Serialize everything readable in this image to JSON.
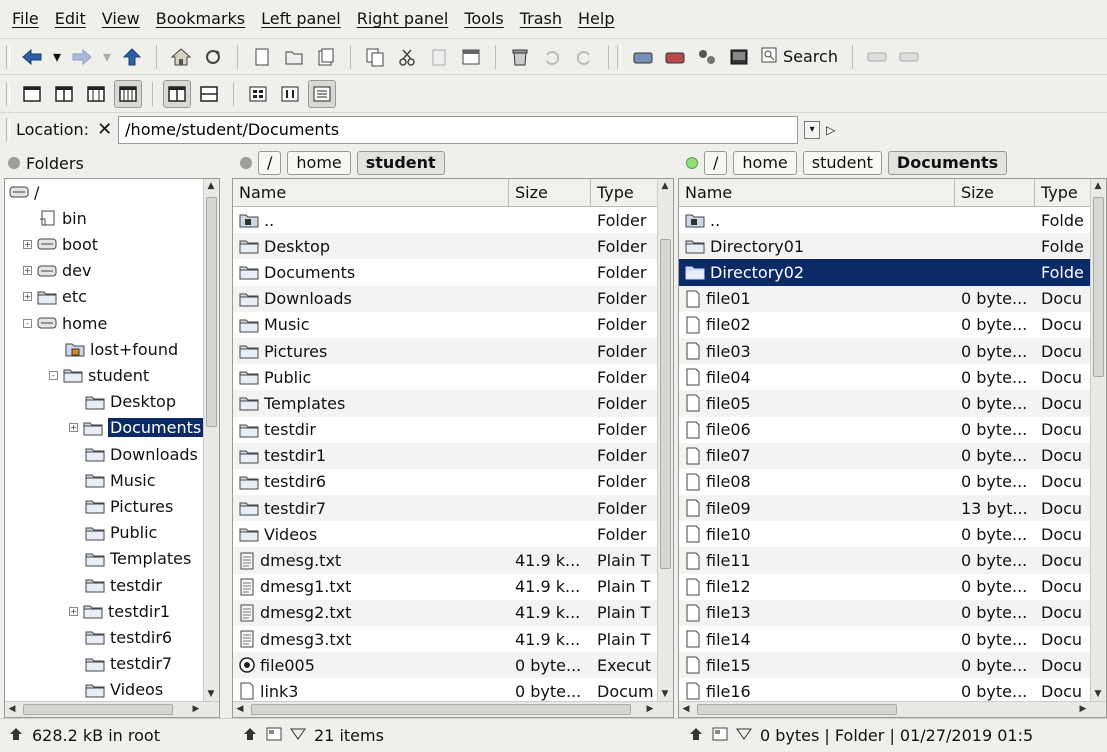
{
  "menu": [
    "File",
    "Edit",
    "View",
    "Bookmarks",
    "Left panel",
    "Right panel",
    "Tools",
    "Trash",
    "Help"
  ],
  "menu_accel": [
    0,
    0,
    0,
    0,
    0,
    0,
    0,
    0,
    0
  ],
  "toolbar": {
    "search_label": "Search"
  },
  "location": {
    "label": "Location:",
    "value": "/home/student/Documents"
  },
  "folders": {
    "title": "Folders",
    "items": [
      {
        "label": "/",
        "depth": 0,
        "icon": "drive"
      },
      {
        "label": "bin",
        "depth": 1,
        "icon": "link"
      },
      {
        "label": "boot",
        "depth": 1,
        "icon": "drive",
        "exp": "+"
      },
      {
        "label": "dev",
        "depth": 1,
        "icon": "drive",
        "exp": "+"
      },
      {
        "label": "etc",
        "depth": 1,
        "icon": "folder",
        "exp": "+"
      },
      {
        "label": "home",
        "depth": 1,
        "icon": "drive",
        "exp": "-"
      },
      {
        "label": "lost+found",
        "depth": 2,
        "icon": "lock-folder"
      },
      {
        "label": "student",
        "depth": 2,
        "icon": "folder",
        "exp": "-"
      },
      {
        "label": "Desktop",
        "depth": 3,
        "icon": "folder"
      },
      {
        "label": "Documents",
        "depth": 3,
        "icon": "folder",
        "exp": "+",
        "selected": true
      },
      {
        "label": "Downloads",
        "depth": 3,
        "icon": "folder"
      },
      {
        "label": "Music",
        "depth": 3,
        "icon": "folder"
      },
      {
        "label": "Pictures",
        "depth": 3,
        "icon": "folder"
      },
      {
        "label": "Public",
        "depth": 3,
        "icon": "folder"
      },
      {
        "label": "Templates",
        "depth": 3,
        "icon": "folder"
      },
      {
        "label": "testdir",
        "depth": 3,
        "icon": "folder"
      },
      {
        "label": "testdir1",
        "depth": 3,
        "icon": "folder",
        "exp": "+"
      },
      {
        "label": "testdir6",
        "depth": 3,
        "icon": "folder"
      },
      {
        "label": "testdir7",
        "depth": 3,
        "icon": "folder"
      },
      {
        "label": "Videos",
        "depth": 3,
        "icon": "folder"
      }
    ]
  },
  "left_panel": {
    "breadcrumbs": [
      "/",
      "home",
      "student"
    ],
    "columns": [
      "Name",
      "Size",
      "Type"
    ],
    "rows": [
      {
        "name": "..",
        "size": "",
        "type": "Folder",
        "icon": "up-folder"
      },
      {
        "name": "Desktop",
        "size": "",
        "type": "Folder",
        "icon": "folder"
      },
      {
        "name": "Documents",
        "size": "",
        "type": "Folder",
        "icon": "folder"
      },
      {
        "name": "Downloads",
        "size": "",
        "type": "Folder",
        "icon": "folder"
      },
      {
        "name": "Music",
        "size": "",
        "type": "Folder",
        "icon": "folder"
      },
      {
        "name": "Pictures",
        "size": "",
        "type": "Folder",
        "icon": "folder"
      },
      {
        "name": "Public",
        "size": "",
        "type": "Folder",
        "icon": "folder"
      },
      {
        "name": "Templates",
        "size": "",
        "type": "Folder",
        "icon": "folder"
      },
      {
        "name": "testdir",
        "size": "",
        "type": "Folder",
        "icon": "folder"
      },
      {
        "name": "testdir1",
        "size": "",
        "type": "Folder",
        "icon": "folder"
      },
      {
        "name": "testdir6",
        "size": "",
        "type": "Folder",
        "icon": "folder"
      },
      {
        "name": "testdir7",
        "size": "",
        "type": "Folder",
        "icon": "folder"
      },
      {
        "name": "Videos",
        "size": "",
        "type": "Folder",
        "icon": "folder"
      },
      {
        "name": "dmesg.txt",
        "size": "41.9 k...",
        "type": "Plain T",
        "icon": "text"
      },
      {
        "name": "dmesg1.txt",
        "size": "41.9 k...",
        "type": "Plain T",
        "icon": "text"
      },
      {
        "name": "dmesg2.txt",
        "size": "41.9 k...",
        "type": "Plain T",
        "icon": "text"
      },
      {
        "name": "dmesg3.txt",
        "size": "41.9 k...",
        "type": "Plain T",
        "icon": "text"
      },
      {
        "name": "file005",
        "size": "0 byte...",
        "type": "Execut",
        "icon": "exec"
      },
      {
        "name": "link3",
        "size": "0 byte...",
        "type": "Docum",
        "icon": "doc"
      }
    ],
    "status": "21 items"
  },
  "right_panel": {
    "breadcrumbs": [
      "/",
      "home",
      "student",
      "Documents"
    ],
    "columns": [
      "Name",
      "Size",
      "Type"
    ],
    "rows": [
      {
        "name": "..",
        "size": "",
        "type": "Folde",
        "icon": "up-folder"
      },
      {
        "name": "Directory01",
        "size": "",
        "type": "Folde",
        "icon": "folder"
      },
      {
        "name": "Directory02",
        "size": "",
        "type": "Folde",
        "icon": "folder",
        "selected": true
      },
      {
        "name": "file01",
        "size": "0 byte...",
        "type": "Docu",
        "icon": "doc"
      },
      {
        "name": "file02",
        "size": "0 byte...",
        "type": "Docu",
        "icon": "doc"
      },
      {
        "name": "file03",
        "size": "0 byte...",
        "type": "Docu",
        "icon": "doc"
      },
      {
        "name": "file04",
        "size": "0 byte...",
        "type": "Docu",
        "icon": "doc"
      },
      {
        "name": "file05",
        "size": "0 byte...",
        "type": "Docu",
        "icon": "doc"
      },
      {
        "name": "file06",
        "size": "0 byte...",
        "type": "Docu",
        "icon": "doc"
      },
      {
        "name": "file07",
        "size": "0 byte...",
        "type": "Docu",
        "icon": "doc"
      },
      {
        "name": "file08",
        "size": "0 byte...",
        "type": "Docu",
        "icon": "doc"
      },
      {
        "name": "file09",
        "size": "13 byt...",
        "type": "Docu",
        "icon": "doc"
      },
      {
        "name": "file10",
        "size": "0 byte...",
        "type": "Docu",
        "icon": "doc"
      },
      {
        "name": "file11",
        "size": "0 byte...",
        "type": "Docu",
        "icon": "doc"
      },
      {
        "name": "file12",
        "size": "0 byte...",
        "type": "Docu",
        "icon": "doc"
      },
      {
        "name": "file13",
        "size": "0 byte...",
        "type": "Docu",
        "icon": "doc"
      },
      {
        "name": "file14",
        "size": "0 byte...",
        "type": "Docu",
        "icon": "doc"
      },
      {
        "name": "file15",
        "size": "0 byte...",
        "type": "Docu",
        "icon": "doc"
      },
      {
        "name": "file16",
        "size": "0 byte...",
        "type": "Docu",
        "icon": "doc"
      }
    ],
    "status": "0 bytes | Folder | 01/27/2019 01:5"
  },
  "status": {
    "folders": "628.2 kB in root"
  },
  "colors": {
    "selection": "#0c2a66",
    "folder": "#cfd8e6",
    "bg": "#efefec"
  }
}
